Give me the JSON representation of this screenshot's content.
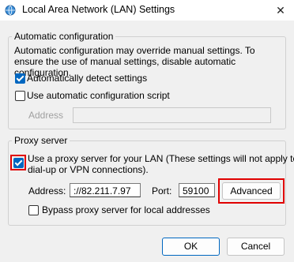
{
  "window": {
    "title": "Local Area Network (LAN) Settings",
    "close_label": "✕"
  },
  "auto_config": {
    "legend": "Automatic configuration",
    "description": "Automatic configuration may override manual settings.  To ensure the use of manual settings, disable automatic configuration.",
    "detect_label": "Automatically detect settings",
    "detect_checked": true,
    "script_label": "Use automatic configuration script",
    "script_checked": false,
    "address_label": "Address",
    "address_value": ""
  },
  "proxy": {
    "legend": "Proxy server",
    "use_proxy_label_line1": "Use a proxy server for your LAN (These settings will not apply to",
    "use_proxy_label_line2": "dial-up or VPN connections).",
    "use_proxy_checked": true,
    "address_label": "Address:",
    "address_value": "://82.211.7.97",
    "port_label": "Port:",
    "port_value": "59100",
    "advanced_label": "Advanced",
    "bypass_label": "Bypass proxy server for local addresses",
    "bypass_checked": false
  },
  "buttons": {
    "ok": "OK",
    "cancel": "Cancel"
  },
  "colors": {
    "accent": "#0067c0",
    "highlight": "#e00000"
  }
}
